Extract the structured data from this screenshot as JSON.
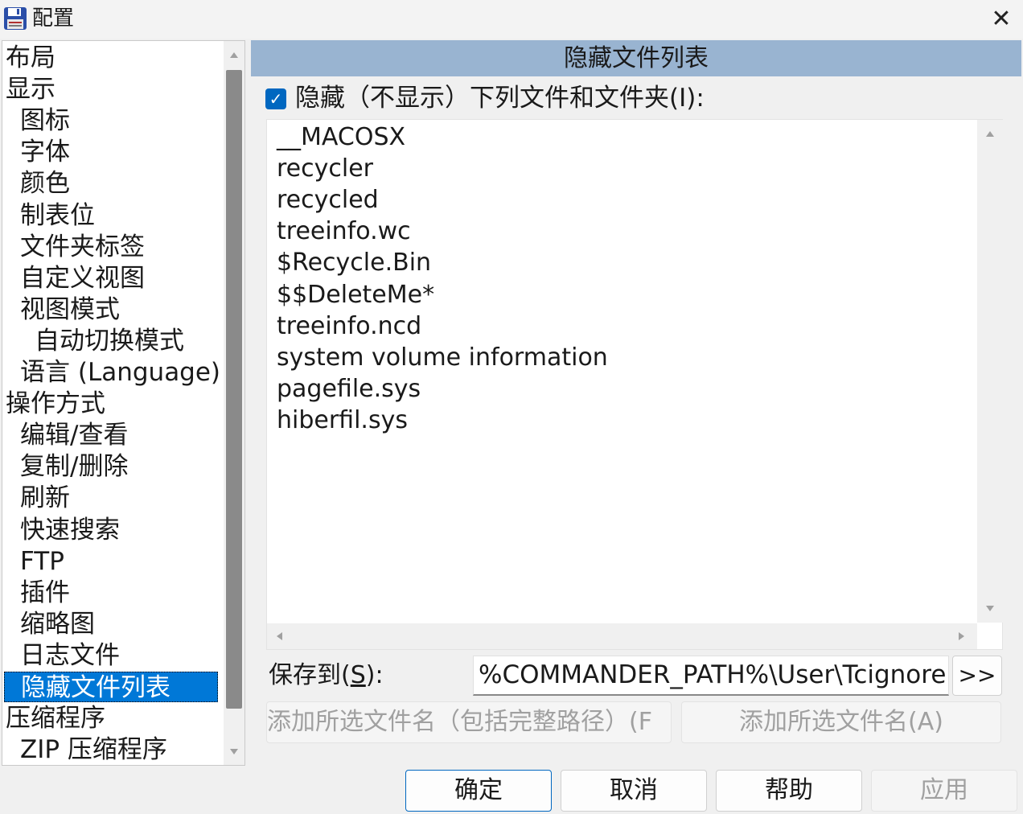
{
  "window": {
    "title": "配置",
    "close_symbol": "✕"
  },
  "tree": {
    "items": [
      {
        "label": "布局",
        "level": 0
      },
      {
        "label": "显示",
        "level": 0
      },
      {
        "label": "图标",
        "level": 1
      },
      {
        "label": "字体",
        "level": 1
      },
      {
        "label": "颜色",
        "level": 1
      },
      {
        "label": "制表位",
        "level": 1
      },
      {
        "label": "文件夹标签",
        "level": 1
      },
      {
        "label": "自定义视图",
        "level": 1
      },
      {
        "label": "视图模式",
        "level": 1
      },
      {
        "label": "自动切换模式",
        "level": 2
      },
      {
        "label": "语言 (Language)",
        "level": 1
      },
      {
        "label": "操作方式",
        "level": 0
      },
      {
        "label": "编辑/查看",
        "level": 1
      },
      {
        "label": "复制/删除",
        "level": 1
      },
      {
        "label": "刷新",
        "level": 1
      },
      {
        "label": "快速搜索",
        "level": 1
      },
      {
        "label": "FTP",
        "level": 1
      },
      {
        "label": "插件",
        "level": 1
      },
      {
        "label": "缩略图",
        "level": 1
      },
      {
        "label": "日志文件",
        "level": 1
      },
      {
        "label": "隐藏文件列表",
        "level": 1,
        "selected": true
      },
      {
        "label": "压缩程序",
        "level": 0
      },
      {
        "label": "ZIP 压缩程序",
        "level": 1
      }
    ]
  },
  "panel": {
    "header": "隐藏文件列表",
    "hide_checkbox": {
      "label": "隐藏（不显示）下列文件和文件夹(I):",
      "checked": true,
      "check_symbol": "✓"
    },
    "files": [
      "__MACOSX",
      "recycler",
      "recycled",
      "treeinfo.wc",
      "$Recycle.Bin",
      "$$DeleteMe*",
      "treeinfo.ncd",
      "system volume information",
      "pagefile.sys",
      "hiberfil.sys"
    ],
    "save_to": {
      "label_prefix": "保存到(",
      "label_accel": "S",
      "label_suffix": "):",
      "value": "%COMMANDER_PATH%\\User\\Tcignore.txt",
      "browse_label": ">>"
    },
    "add_full_path_label": "添加所选文件名（包括完整路径）(F",
    "add_name_label": "添加所选文件名(A)"
  },
  "footer": {
    "ok_label": "确定",
    "cancel_label": "取消",
    "help_label": "帮助",
    "apply_label": "应用"
  },
  "colors": {
    "header_bg": "#99b4d1",
    "selection": "#0078d7",
    "checkbox": "#0067c0"
  }
}
